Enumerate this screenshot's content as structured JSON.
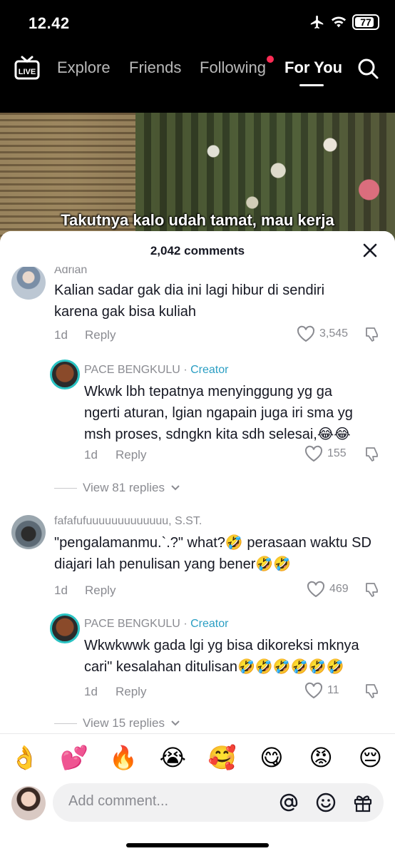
{
  "status_bar": {
    "time": "12.42",
    "battery": "77"
  },
  "nav": {
    "tabs": [
      {
        "label": "Explore"
      },
      {
        "label": "Friends"
      },
      {
        "label": "Following"
      },
      {
        "label": "For You"
      }
    ],
    "active_tab": "For You"
  },
  "video": {
    "caption": "Takutnya kalo udah tamat, mau kerja"
  },
  "comments_sheet": {
    "count": "2,042 comments",
    "comments": [
      {
        "username": "Adrian",
        "text": "Kalian sadar gak dia ini lagi hibur di sendiri karena gak bisa kuliah",
        "time": "1d",
        "reply": "Reply",
        "likes": "3,545",
        "replies": [
          {
            "username": "PACE BENGKULU",
            "separator": "·",
            "badge": "Creator",
            "text": "Wkwk lbh tepatnya menyinggung yg ga ngerti aturan, lgian ngapain juga iri sma yg msh proses, sdngkn kita sdh selesai,😂😂",
            "time": "1d",
            "reply": "Reply",
            "likes": "155"
          }
        ],
        "view_replies": "View 81 replies"
      },
      {
        "username": "fafafufuuuuuuuuuuuuu, S.ST.",
        "text": "\"pengalamanmu.`.?\" what?🤣 perasaan waktu SD diajari lah penulisan yang bener🤣🤣",
        "time": "1d",
        "reply": "Reply",
        "likes": "469",
        "replies": [
          {
            "username": "PACE BENGKULU",
            "separator": "·",
            "badge": "Creator",
            "text": "Wkwkwwk gada lgi yg bisa dikoreksi mknya cari\" kesalahan ditulisan🤣🤣🤣🤣🤣🤣",
            "time": "1d",
            "reply": "Reply",
            "likes": "11"
          }
        ],
        "view_replies": "View 15 replies"
      }
    ]
  },
  "emoji_bar": [
    "👌",
    "💕",
    "🔥",
    "😭",
    "🥰",
    "😋",
    "😡",
    "😔"
  ],
  "input": {
    "placeholder": "Add comment..."
  },
  "colors": {
    "accent": "#fe2c55",
    "creator": "#2a9ec3",
    "meta": "#8a8b91"
  }
}
